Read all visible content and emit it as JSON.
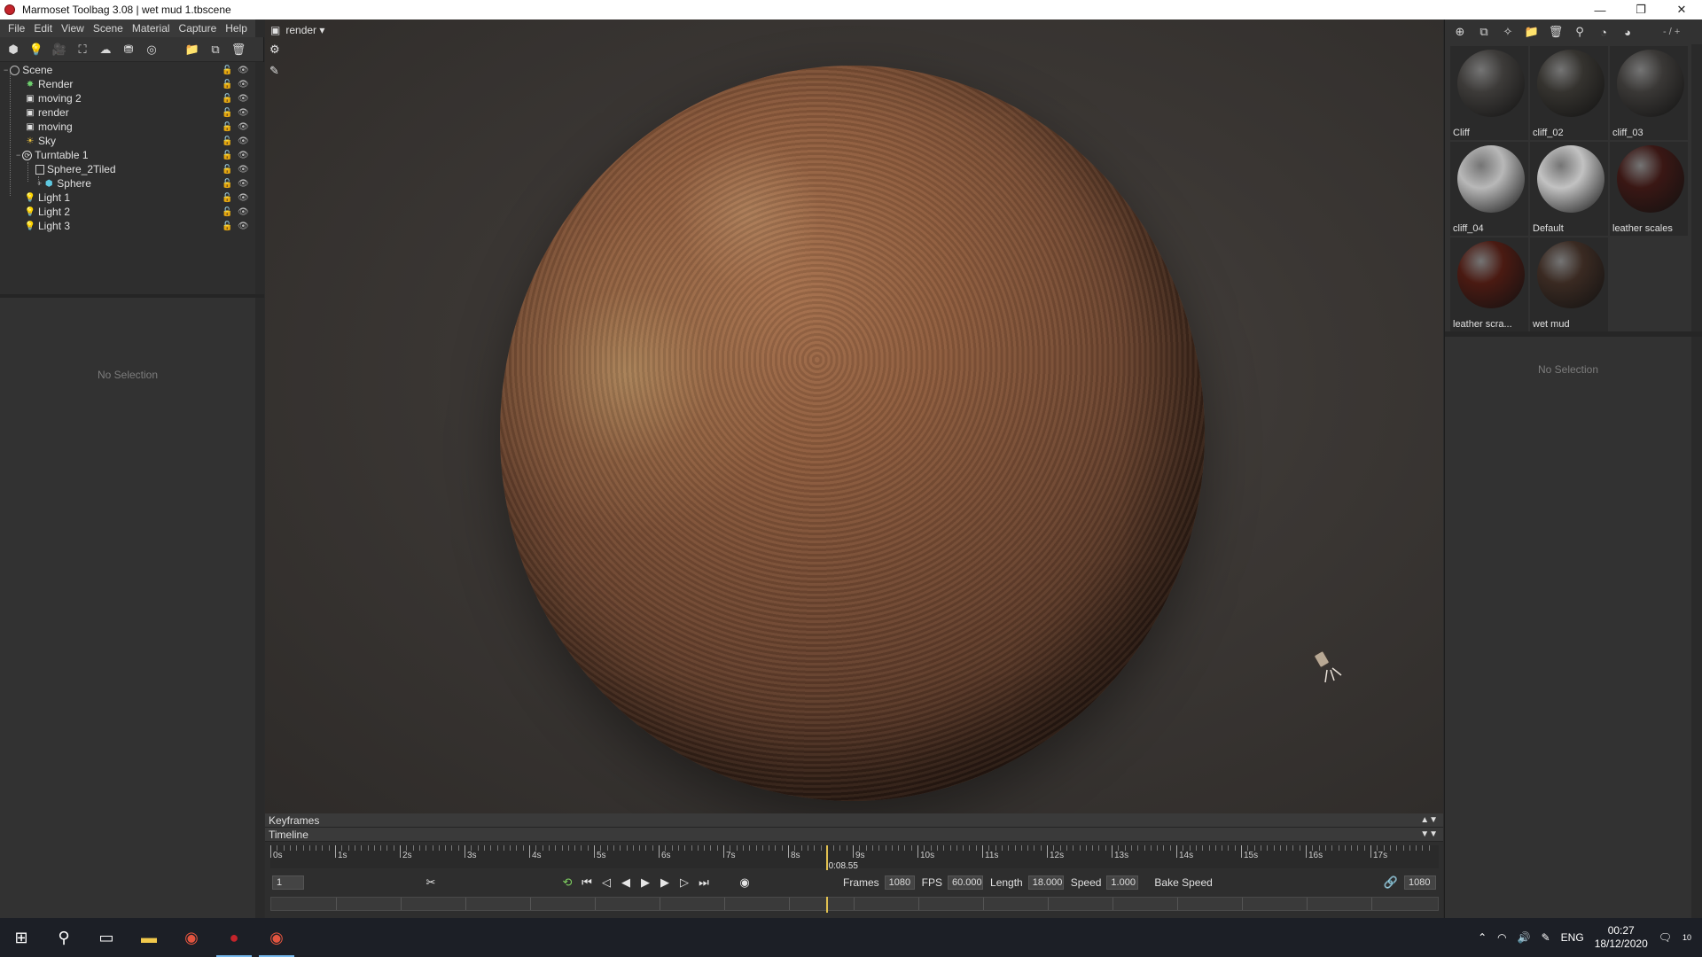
{
  "window": {
    "title": "Marmoset Toolbag 3.08  |  wet mud 1.tbscene",
    "minimize": "—",
    "maximize": "❐",
    "close": "✕"
  },
  "menu": [
    "File",
    "Edit",
    "View",
    "Scene",
    "Material",
    "Capture",
    "Help"
  ],
  "scene_tree": {
    "items": [
      {
        "label": "Scene",
        "icon": "scene-icon"
      },
      {
        "label": "Render",
        "icon": "render-icon"
      },
      {
        "label": "moving 2",
        "icon": "camera-icon"
      },
      {
        "label": "render",
        "icon": "camera-icon"
      },
      {
        "label": "moving",
        "icon": "camera-icon"
      },
      {
        "label": "Sky",
        "icon": "sky-icon"
      },
      {
        "label": "Turntable 1",
        "icon": "turntable-icon"
      },
      {
        "label": "Sphere_2Tiled",
        "icon": "mesh-icon"
      },
      {
        "label": "Sphere",
        "icon": "sphere-icon"
      },
      {
        "label": "Light 1",
        "icon": "light-icon"
      },
      {
        "label": "Light 2",
        "icon": "light-icon"
      },
      {
        "label": "Light 3",
        "icon": "light-icon"
      }
    ]
  },
  "left_props": {
    "empty_text": "No Selection"
  },
  "viewport": {
    "camera_label": "render ▾"
  },
  "timeline": {
    "keyframes_label": "Keyframes",
    "timeline_label": "Timeline",
    "ruler_labels": [
      "0s",
      "1s",
      "2s",
      "3s",
      "4s",
      "5s",
      "6s",
      "7s",
      "8s",
      "9s",
      "10s",
      "11s",
      "12s",
      "13s",
      "14s",
      "15s",
      "16s",
      "17s"
    ],
    "current_time": "0:08.55",
    "current_frame": "1",
    "frames_label": "Frames",
    "frames_value": "1080",
    "fps_label": "FPS",
    "fps_value": "60.000",
    "length_label": "Length",
    "length_value": "18.000",
    "speed_label": "Speed",
    "speed_value": "1.000",
    "bake_speed_label": "Bake Speed",
    "end_frame": "1080",
    "playhead_position": 0.4754
  },
  "materials": {
    "page_indicator": "- / +",
    "items": [
      {
        "label": "Cliff",
        "color": "#3d3b39"
      },
      {
        "label": "cliff_02",
        "color": "#35332f"
      },
      {
        "label": "cliff_03",
        "color": "#3a3836"
      },
      {
        "label": "cliff_04",
        "color": "#b8b8b8"
      },
      {
        "label": "Default",
        "color": "#c2c2c2"
      },
      {
        "label": "leather scales",
        "color": "#3a1714"
      },
      {
        "label": "leather scra...",
        "color": "#4a1a12"
      },
      {
        "label": "wet mud",
        "color": "#3a2a22"
      }
    ]
  },
  "right_props": {
    "empty_text": "No Selection"
  },
  "taskbar": {
    "language": "ENG",
    "time": "00:27",
    "date": "18/12/2020",
    "notifications": "10"
  }
}
